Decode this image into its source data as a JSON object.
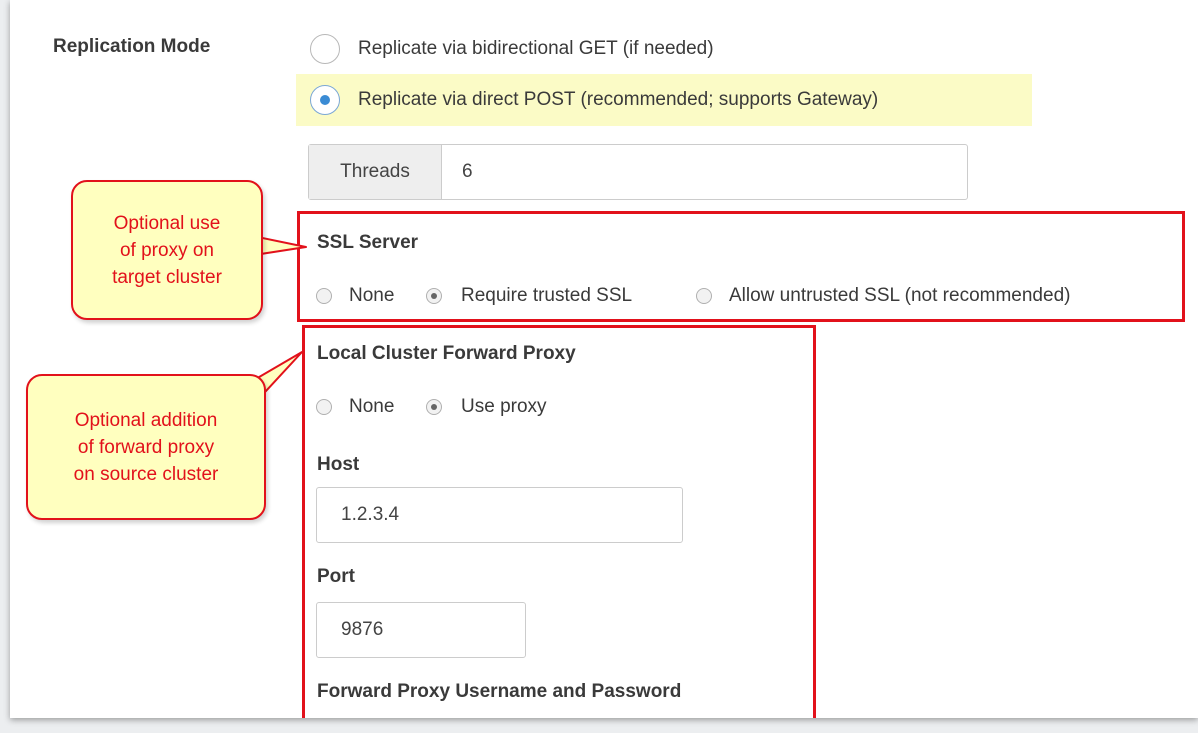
{
  "replication_mode": {
    "label": "Replication Mode",
    "options": [
      {
        "label": "Replicate via bidirectional GET (if needed)",
        "selected": false
      },
      {
        "label": "Replicate via direct POST (recommended; supports Gateway)",
        "selected": true
      }
    ],
    "threads": {
      "label": "Threads",
      "value": "6"
    }
  },
  "ssl_server": {
    "title": "SSL Server",
    "options": [
      {
        "label": "None",
        "selected": false
      },
      {
        "label": "Require trusted SSL",
        "selected": true
      },
      {
        "label": "Allow untrusted SSL (not recommended)",
        "selected": false
      }
    ]
  },
  "forward_proxy": {
    "title": "Local Cluster Forward Proxy",
    "options": [
      {
        "label": "None",
        "selected": false
      },
      {
        "label": "Use proxy",
        "selected": true
      }
    ],
    "host": {
      "label": "Host",
      "value": "1.2.3.4"
    },
    "port": {
      "label": "Port",
      "value": "9876"
    },
    "credentials_label": "Forward Proxy Username and Password"
  },
  "callouts": {
    "target_proxy": "Optional use\nof proxy on\ntarget cluster",
    "source_proxy": "Optional addition\nof forward proxy\non source cluster"
  },
  "colors": {
    "annotation_red": "#e2111b",
    "callout_fill": "#ffffbf",
    "selected_highlight": "#fbfbc6",
    "radio_blue": "#3a8bd4"
  }
}
